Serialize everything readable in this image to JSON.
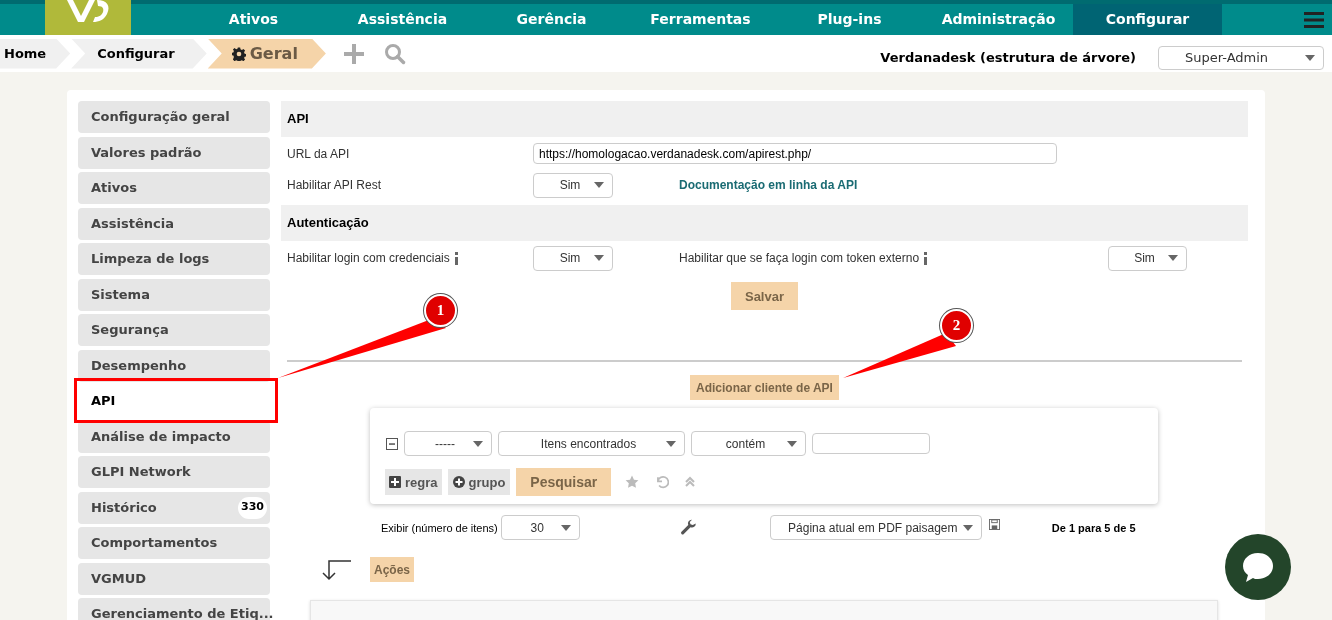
{
  "nav": {
    "items": [
      {
        "label": "Ativos",
        "selected": false
      },
      {
        "label": "Assistência",
        "selected": false
      },
      {
        "label": "Gerência",
        "selected": false
      },
      {
        "label": "Ferramentas",
        "selected": false
      },
      {
        "label": "Plug-ins",
        "selected": false
      },
      {
        "label": "Administração",
        "selected": false
      },
      {
        "label": "Configurar",
        "selected": true
      }
    ]
  },
  "breadcrumbs": [
    {
      "label": "Home",
      "kind": "plain"
    },
    {
      "label": "Configurar",
      "kind": "plain"
    },
    {
      "label": "Geral",
      "kind": "current"
    }
  ],
  "entity": "Verdanadesk (estrutura de árvore)",
  "profile": "Super-Admin",
  "sidebar": [
    {
      "label": "Configuração geral",
      "selected": false
    },
    {
      "label": "Valores padrão",
      "selected": false
    },
    {
      "label": "Ativos",
      "selected": false
    },
    {
      "label": "Assistência",
      "selected": false
    },
    {
      "label": "Limpeza de logs",
      "selected": false
    },
    {
      "label": "Sistema",
      "selected": false
    },
    {
      "label": "Segurança",
      "selected": false
    },
    {
      "label": "Desempenho",
      "selected": false
    },
    {
      "label": "API",
      "selected": true
    },
    {
      "label": "Análise de impacto",
      "selected": false
    },
    {
      "label": "GLPI Network",
      "selected": false
    },
    {
      "label": "Histórico",
      "selected": false,
      "badge": "330"
    },
    {
      "label": "Comportamentos",
      "selected": false
    },
    {
      "label": "VGMUD",
      "selected": false
    },
    {
      "label": "Gerenciamento de Etiq...",
      "selected": false
    }
  ],
  "api_section": {
    "title": "API",
    "url_label": "URL da API",
    "url_value": "https://homologacao.verdanadesk.com/apirest.php/",
    "rest_label": "Habilitar API Rest",
    "rest_value": "Sim",
    "doc_link": "Documentação em linha da API"
  },
  "auth_section": {
    "title": "Autenticação",
    "credentials_label": "Habilitar login com credenciais",
    "credentials_value": "Sim",
    "token_label": "Habilitar que se faça login com token externo",
    "token_value": "Sim"
  },
  "save_button": "Salvar",
  "add_client_button": "Adicionar cliente de API",
  "search": {
    "field": "-----",
    "item": "Itens encontrados",
    "operator": "contém",
    "rule_button": "regra",
    "group_button": "grupo",
    "search_button": "Pesquisar"
  },
  "display_label": "Exibir (número de itens)",
  "display_value": "30",
  "export_value": "Página atual em PDF paisagem",
  "pagination": "De 1 para 5 de 5",
  "actions_button": "Ações",
  "callouts": [
    "1",
    "2"
  ]
}
